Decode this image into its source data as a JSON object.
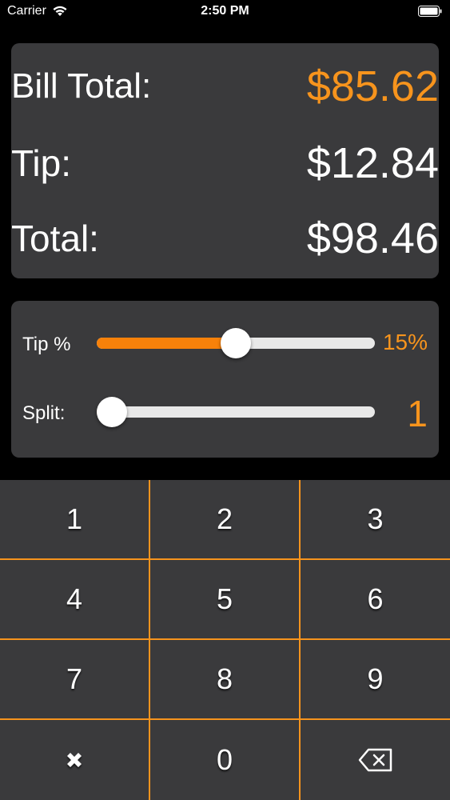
{
  "status_bar": {
    "carrier": "Carrier",
    "time": "2:50 PM"
  },
  "totals": {
    "bill_total_label": "Bill Total:",
    "bill_total_value": "$85.62",
    "tip_label": "Tip:",
    "tip_value": "$12.84",
    "total_label": "Total:",
    "total_value": "$98.46"
  },
  "sliders": {
    "tip": {
      "label": "Tip %",
      "value_text": "15%",
      "level_fraction": 0.5
    },
    "split": {
      "label": "Split:",
      "value_text": "1",
      "level_fraction": 0.0
    }
  },
  "keypad": {
    "keys": [
      "1",
      "2",
      "3",
      "4",
      "5",
      "6",
      "7",
      "8",
      "9"
    ],
    "zero": "0",
    "clear_icon": "x-icon",
    "backspace_icon": "backspace-icon"
  },
  "colors": {
    "accent": "#f7941d",
    "panel": "#3a3a3c",
    "background": "#000000"
  }
}
